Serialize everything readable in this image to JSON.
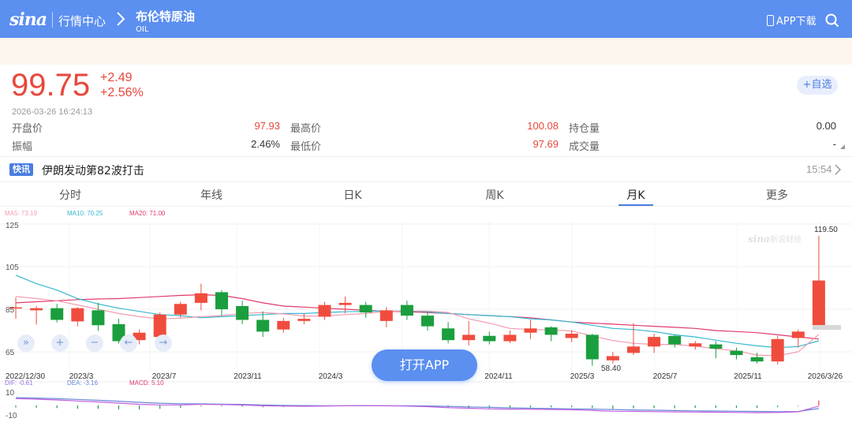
{
  "header": {
    "logo": "sina",
    "section": "行情中心",
    "product_name": "布伦特原油",
    "product_code": "OIL",
    "app_download": "APP下载"
  },
  "quote": {
    "price": "99.75",
    "change": "+2.49",
    "change_pct": "+2.56%",
    "timestamp": "2026-03-26   16:24:13",
    "favorite_label": "+自选",
    "stats": {
      "open_label": "开盘价",
      "open": "97.93",
      "high_label": "最高价",
      "high": "100.08",
      "oi_label": "持仓量",
      "oi": "0.00",
      "amp_label": "振幅",
      "amp": "2.46%",
      "low_label": "最低价",
      "low": "97.69",
      "vol_label": "成交量",
      "vol": "-"
    }
  },
  "news": {
    "badge": "快讯",
    "title": "伊朗发动第82波打击",
    "time": "15:54"
  },
  "tabs": [
    "分时",
    "年线",
    "日K",
    "周K",
    "月K",
    "更多"
  ],
  "active_tab": "月K",
  "chart_controls": [
    "»",
    "+",
    "−",
    "←",
    "→"
  ],
  "open_app_label": "打开APP",
  "colors": {
    "up": "#f04c3e",
    "down": "#1a9e3e",
    "ma5": "#f29cb0",
    "ma10": "#36b8d0",
    "ma20": "#e03a6a",
    "accent": "#5b8ff0"
  },
  "chart_data": {
    "type": "candlestick",
    "legend": {
      "ma5": "MA5: 73.19",
      "ma10": "MA10: 70.25",
      "ma20": "MA20: 71.00"
    },
    "y_ticks": [
      "125",
      "105",
      "85",
      "65"
    ],
    "ylim": [
      57,
      127
    ],
    "x_ticks": [
      "2022/12/30",
      "2023/3",
      "2023/7",
      "2023/11",
      "2024/3",
      "2024/11",
      "2025/3",
      "2025/7",
      "2025/11",
      "2026/3/26"
    ],
    "annotations": {
      "max": "119.50",
      "min": "58.40"
    },
    "watermark": "新浪财经",
    "candles": [
      [
        85.5,
        85.9,
        90.5,
        80.5
      ],
      [
        84.5,
        85.5,
        86.5,
        77.8
      ],
      [
        85.5,
        80.0,
        87.5,
        78.8
      ],
      [
        79.3,
        85.5,
        86.0,
        77.0
      ],
      [
        84.5,
        77.5,
        88.0,
        74.8
      ],
      [
        78.0,
        70.0,
        80.5,
        69.0
      ],
      [
        70.5,
        74.0,
        75.5,
        68.5
      ],
      [
        72.0,
        82.5,
        83.5,
        69.5
      ],
      [
        82.5,
        87.5,
        88.5,
        81.0
      ],
      [
        88.0,
        92.5,
        97.0,
        84.5
      ],
      [
        93.0,
        85.0,
        94.0,
        82.0
      ],
      [
        86.5,
        80.0,
        89.0,
        78.0
      ],
      [
        80.0,
        74.5,
        84.0,
        72.0
      ],
      [
        75.5,
        79.5,
        81.0,
        74.0
      ],
      [
        79.5,
        80.5,
        83.0,
        78.0
      ],
      [
        81.5,
        87.0,
        88.5,
        80.0
      ],
      [
        87.0,
        88.0,
        91.0,
        83.0
      ],
      [
        87.0,
        83.5,
        88.5,
        81.0
      ],
      [
        79.5,
        84.5,
        86.0,
        76.5
      ],
      [
        87.0,
        82.0,
        89.0,
        80.0
      ],
      [
        82.0,
        77.0,
        83.5,
        75.0
      ],
      [
        76.0,
        70.5,
        79.0,
        69.0
      ],
      [
        70.5,
        73.0,
        79.5,
        68.0
      ],
      [
        72.5,
        70.0,
        74.5,
        68.5
      ],
      [
        70.0,
        73.0,
        75.0,
        69.0
      ],
      [
        74.0,
        76.0,
        80.0,
        71.0
      ],
      [
        76.5,
        73.0,
        77.0,
        70.0
      ],
      [
        71.5,
        73.5,
        75.0,
        69.5
      ],
      [
        73.0,
        61.5,
        73.5,
        58.4
      ],
      [
        61.0,
        63.0,
        65.0,
        59.5
      ],
      [
        64.5,
        67.5,
        78.5,
        63.5
      ],
      [
        67.5,
        72.0,
        73.5,
        64.5
      ],
      [
        72.5,
        68.5,
        73.0,
        67.0
      ],
      [
        67.5,
        69.0,
        70.0,
        66.0
      ],
      [
        68.5,
        66.5,
        70.0,
        62.0
      ],
      [
        65.5,
        63.5,
        67.0,
        61.5
      ],
      [
        62.5,
        60.5,
        64.5,
        59.5
      ],
      [
        60.5,
        71.0,
        72.5,
        59.0
      ],
      [
        71.5,
        74.5,
        75.5,
        67.0
      ],
      [
        77.5,
        98.5,
        119.5,
        77.5
      ]
    ],
    "ma5": [
      91,
      90,
      89,
      87,
      85,
      83,
      81.5,
      80.5,
      80.8,
      81.5,
      82,
      83,
      83.5,
      82.8,
      81.8,
      81.8,
      82.5,
      83,
      84,
      84.2,
      84.2,
      83.5,
      80.5,
      78.5,
      76,
      75.5,
      75.3,
      74.8,
      72.5,
      70.3,
      69,
      68.5,
      68.5,
      67.7,
      66.4,
      65.5,
      63.5,
      63.2,
      65,
      73.2
    ],
    "ma10": [
      101,
      97,
      94,
      90,
      87.5,
      85.5,
      84,
      82.5,
      82,
      81,
      81.5,
      82,
      82.5,
      83,
      83,
      83.5,
      83.8,
      84,
      84.2,
      84.2,
      83.8,
      83,
      82.5,
      82,
      81.5,
      80.5,
      80,
      79,
      77.5,
      76,
      75.5,
      74.5,
      73,
      72,
      70.5,
      69,
      67.8,
      67,
      67.5,
      70.2
    ],
    "ma20": [
      88,
      88.5,
      89,
      89.5,
      89.8,
      90,
      90.5,
      91,
      91.5,
      91.8,
      91.5,
      90,
      88,
      86.5,
      86,
      85.5,
      85,
      84.5,
      84,
      83.8,
      83.5,
      83,
      82.5,
      82,
      81.5,
      81,
      80,
      79,
      78.5,
      78,
      77.5,
      77,
      76.5,
      76,
      75,
      74.5,
      74,
      73,
      72,
      71
    ],
    "macd": {
      "legend": {
        "dif": "DIF: -0.61",
        "dea": "DEA: -3.16",
        "macd": "MACD: 5.10"
      },
      "y_ticks": [
        "10",
        "-10"
      ],
      "ylim": [
        -12,
        12
      ],
      "dif": [
        7,
        6.4,
        5.6,
        4.6,
        3.6,
        2.4,
        1.2,
        0.6,
        0.6,
        1.2,
        1.0,
        0.5,
        -0.3,
        -0.6,
        -0.8,
        -0.6,
        -0.2,
        -0.1,
        -0.3,
        -0.6,
        -1.2,
        -2.2,
        -2.8,
        -3.4,
        -3.7,
        -3.8,
        -4.0,
        -4.3,
        -5.0,
        -5.8,
        -6.0,
        -6.2,
        -6.5,
        -6.6,
        -6.8,
        -7.0,
        -7.3,
        -7.1,
        -6.4,
        -0.6
      ],
      "dea": [
        8,
        7.5,
        6.9,
        6.2,
        5.3,
        4.3,
        3.2,
        2.3,
        1.8,
        1.6,
        1.4,
        1.1,
        0.6,
        0.2,
        -0.1,
        -0.2,
        -0.2,
        -0.2,
        -0.2,
        -0.3,
        -0.5,
        -0.9,
        -1.4,
        -1.9,
        -2.4,
        -2.8,
        -3.1,
        -3.4,
        -3.7,
        -4.1,
        -4.5,
        -4.8,
        -5.1,
        -5.4,
        -5.6,
        -5.8,
        -6.0,
        -6.2,
        -6.1,
        -3.16
      ],
      "hist": [
        -2.0,
        -2.2,
        -2.6,
        -3.2,
        -3.4,
        -3.8,
        -4.0,
        -3.4,
        -2.4,
        -0.8,
        -0.8,
        -1.2,
        -1.8,
        -1.6,
        -1.4,
        -0.8,
        0,
        0.2,
        -0.2,
        -0.6,
        -1.4,
        -2.6,
        -2.8,
        -3.0,
        -2.6,
        -2.0,
        -1.8,
        -1.8,
        -2.6,
        -3.4,
        -3.0,
        -2.8,
        -2.8,
        -2.4,
        -2.4,
        -2.4,
        -2.6,
        -1.8,
        -0.6,
        5.1
      ]
    }
  }
}
